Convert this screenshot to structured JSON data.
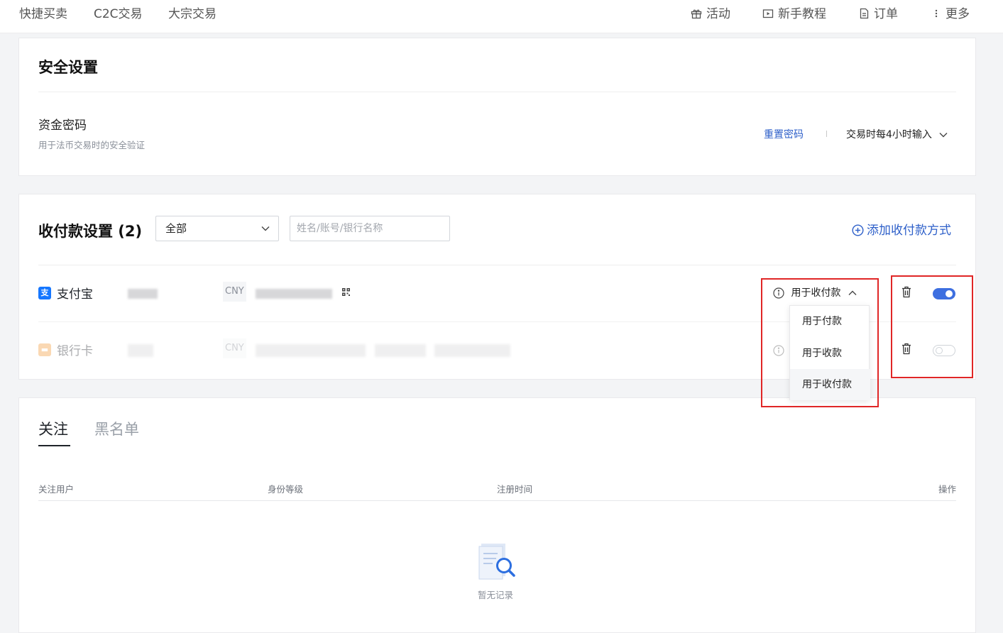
{
  "nav": {
    "left": [
      "快捷买卖",
      "C2C交易",
      "大宗交易"
    ],
    "activity": "活动",
    "tutorial": "新手教程",
    "orders": "订单",
    "more": "更多"
  },
  "security": {
    "title": "安全设置",
    "fund_password": {
      "label": "资金密码",
      "desc": "用于法币交易时的安全验证",
      "reset": "重置密码",
      "mode": "交易时每4小时输入"
    }
  },
  "payment": {
    "title": "收付款设置 (2)",
    "filter_value": "全部",
    "search_placeholder": "姓名/账号/银行名称",
    "add": "添加收付款方式",
    "rows": [
      {
        "method": "支付宝",
        "currency": "CNY",
        "usage": "用于收付款",
        "enabled": true
      },
      {
        "method": "银行卡",
        "currency": "CNY",
        "enabled": false
      }
    ],
    "dropdown": [
      "用于付款",
      "用于收款",
      "用于收付款"
    ]
  },
  "follow": {
    "tabs": [
      "关注",
      "黑名单"
    ],
    "columns": [
      "关注用户",
      "身份等级",
      "注册时间",
      "操作"
    ],
    "empty": "暂无记录"
  },
  "colors": {
    "link": "#2d5fc9",
    "toggle_on": "#3d6fe0",
    "alipay": "#1677ff",
    "bank": "#f39b3b",
    "highlight": "#e02626"
  }
}
